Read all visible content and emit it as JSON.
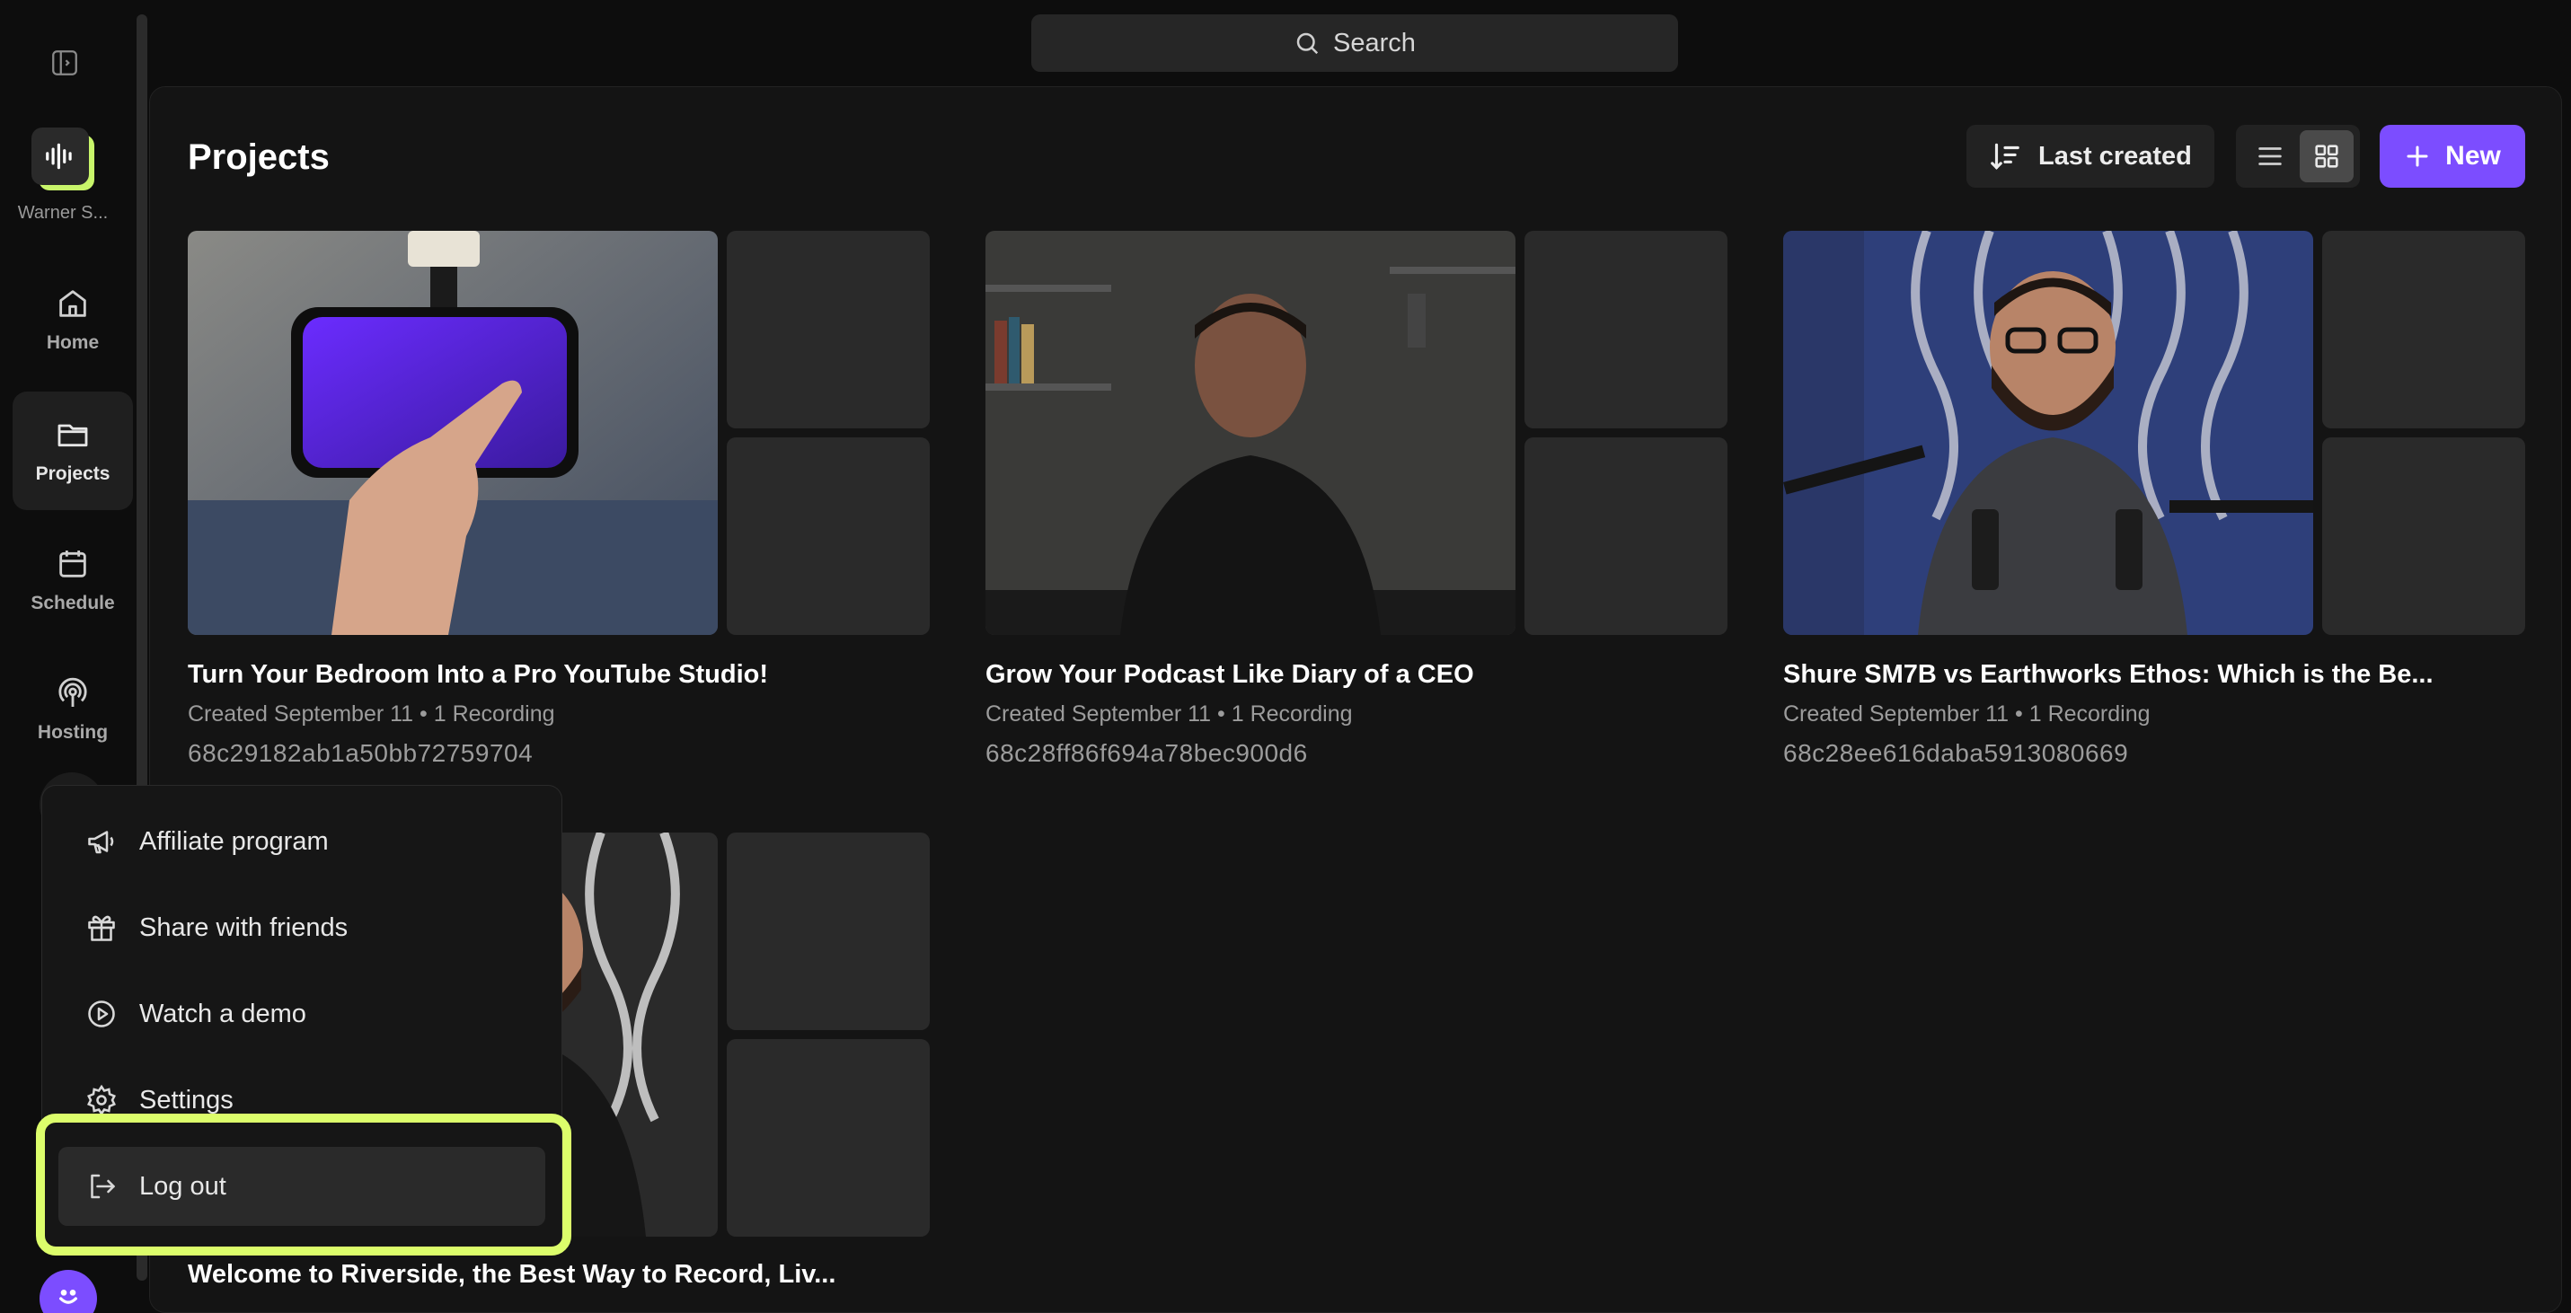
{
  "sidebar": {
    "studio_name": "Warner S...",
    "items": [
      {
        "label": "Home",
        "icon": "home-icon"
      },
      {
        "label": "Projects",
        "icon": "folder-icon"
      },
      {
        "label": "Schedule",
        "icon": "calendar-icon"
      },
      {
        "label": "Hosting",
        "icon": "podcast-icon"
      }
    ],
    "active": "Projects"
  },
  "search": {
    "label": "Search"
  },
  "page": {
    "title": "Projects",
    "sort_label": "Last created",
    "new_label": "New"
  },
  "projects": [
    {
      "title": "Turn Your Bedroom Into a Pro YouTube Studio!",
      "meta": "Created September 11 • 1 Recording",
      "id": "68c29182ab1a50bb72759704"
    },
    {
      "title": "Grow Your Podcast Like Diary of a CEO",
      "meta": "Created September 11 • 1 Recording",
      "id": "68c28ff86f694a78bec900d6"
    },
    {
      "title": "Shure SM7B vs Earthworks Ethos: Which is the Be...",
      "meta": "Created September 11 • 1 Recording",
      "id": "68c28ee616daba5913080669"
    },
    {
      "title": "Welcome to Riverside, the Best Way to Record, Liv..."
    }
  ],
  "menu": {
    "items": [
      {
        "label": "Affiliate program",
        "icon": "megaphone-icon"
      },
      {
        "label": "Share with friends",
        "icon": "gift-icon"
      },
      {
        "label": "Watch a demo",
        "icon": "play-circle-icon"
      },
      {
        "label": "Settings",
        "icon": "gear-icon"
      },
      {
        "label": "Log out",
        "icon": "logout-icon"
      }
    ],
    "highlighted": "Log out"
  },
  "help": {
    "label": "?"
  },
  "colors": {
    "accent": "#7c4dff",
    "highlight_ring": "#dcfd6b",
    "brand_green": "#c8f56a"
  }
}
